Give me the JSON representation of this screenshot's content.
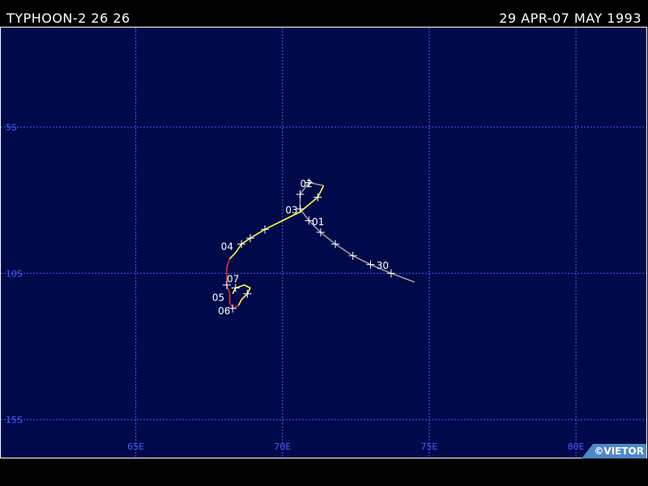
{
  "header": {
    "title": "TYPHOON-2 26 26",
    "date_range": "29 APR-07 MAY 1993"
  },
  "map": {
    "background_color": "#000a4a",
    "grid_color": "#4a5cff",
    "lon_range": [
      60.4,
      82.4
    ],
    "lat_range": [
      -1.6,
      -16.3
    ],
    "lon_ticks": [
      {
        "value": 65,
        "label": "65E"
      },
      {
        "value": 70,
        "label": "70E"
      },
      {
        "value": 75,
        "label": "75E"
      },
      {
        "value": 80,
        "label": "80E"
      }
    ],
    "lat_ticks": [
      {
        "value": -5,
        "label": "5S"
      },
      {
        "value": -10,
        "label": "10S"
      },
      {
        "value": -15,
        "label": "15S"
      }
    ]
  },
  "track": {
    "segments": [
      {
        "stage": "depression",
        "color": "#9a9a9a",
        "points": [
          [
            74.5,
            -10.3
          ],
          [
            73.7,
            -10.0
          ],
          [
            73.0,
            -9.7
          ],
          [
            72.4,
            -9.4
          ],
          [
            71.8,
            -9.0
          ],
          [
            71.3,
            -8.6
          ],
          [
            70.9,
            -8.2
          ],
          [
            70.6,
            -7.8
          ],
          [
            70.6,
            -7.3
          ],
          [
            70.9,
            -6.9
          ],
          [
            71.4,
            -7.0
          ]
        ]
      },
      {
        "stage": "storm",
        "color": "#ffff40",
        "points": [
          [
            71.4,
            -7.0
          ],
          [
            71.2,
            -7.4
          ],
          [
            70.6,
            -7.9
          ],
          [
            70.0,
            -8.2
          ],
          [
            69.4,
            -8.5
          ],
          [
            68.9,
            -8.8
          ],
          [
            68.6,
            -9.0
          ],
          [
            68.4,
            -9.3
          ],
          [
            68.2,
            -9.5
          ]
        ]
      },
      {
        "stage": "typhoon",
        "color": "#e03030",
        "points": [
          [
            68.2,
            -9.5
          ],
          [
            68.1,
            -9.8
          ],
          [
            68.1,
            -10.1
          ],
          [
            68.1,
            -10.4
          ],
          [
            68.2,
            -10.7
          ],
          [
            68.2,
            -11.0
          ],
          [
            68.3,
            -11.2
          ],
          [
            68.5,
            -11.1
          ]
        ]
      },
      {
        "stage": "storm",
        "color": "#ffff40",
        "points": [
          [
            68.5,
            -11.1
          ],
          [
            68.6,
            -10.9
          ],
          [
            68.8,
            -10.7
          ],
          [
            68.9,
            -10.5
          ],
          [
            68.7,
            -10.4
          ],
          [
            68.4,
            -10.5
          ],
          [
            68.3,
            -10.7
          ]
        ]
      }
    ],
    "markers": [
      [
        73.7,
        -10.0
      ],
      [
        73.0,
        -9.7
      ],
      [
        72.4,
        -9.4
      ],
      [
        71.8,
        -9.0
      ],
      [
        71.3,
        -8.6
      ],
      [
        70.9,
        -8.2
      ],
      [
        70.6,
        -7.8
      ],
      [
        70.6,
        -7.3
      ],
      [
        70.9,
        -6.9
      ],
      [
        71.2,
        -7.4
      ],
      [
        69.4,
        -8.5
      ],
      [
        68.9,
        -8.8
      ],
      [
        68.6,
        -9.0
      ],
      [
        68.1,
        -10.4
      ],
      [
        68.3,
        -11.2
      ],
      [
        68.8,
        -10.7
      ],
      [
        68.4,
        -10.5
      ]
    ],
    "day_labels": [
      {
        "text": "30",
        "lon": 73.2,
        "lat": -9.85
      },
      {
        "text": "01",
        "lon": 71.0,
        "lat": -8.35
      },
      {
        "text": "02",
        "lon": 70.6,
        "lat": -7.05
      },
      {
        "text": "03",
        "lon": 70.1,
        "lat": -7.95
      },
      {
        "text": "04",
        "lon": 67.9,
        "lat": -9.2
      },
      {
        "text": "07",
        "lon": 68.1,
        "lat": -10.3
      },
      {
        "text": "05",
        "lon": 67.6,
        "lat": -10.95
      },
      {
        "text": "06",
        "lon": 67.8,
        "lat": -11.4
      }
    ]
  },
  "copyright": "©VIETOR"
}
